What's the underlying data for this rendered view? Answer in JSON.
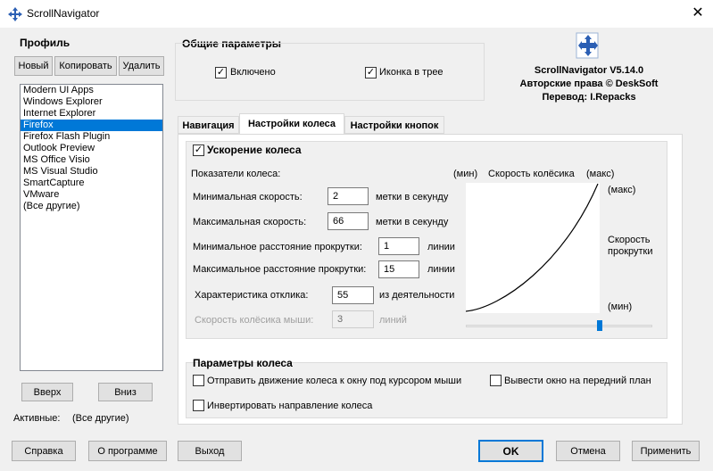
{
  "window": {
    "title": "ScrollNavigator"
  },
  "profile": {
    "title": "Профиль",
    "buttons": {
      "new": "Новый",
      "copy": "Копировать",
      "delete": "Удалить"
    },
    "items": [
      "Modern UI Apps",
      "Windows Explorer",
      "Internet Explorer",
      "Firefox",
      "Firefox Flash Plugin",
      "Outlook Preview",
      "MS Office Visio",
      "MS Visual Studio",
      "SmartCapture",
      "VMware",
      "(Все другие)"
    ],
    "selected_index": 3,
    "up": "Вверх",
    "down": "Вниз",
    "active_label": "Активные:",
    "active_value": "(Все другие)"
  },
  "general": {
    "title": "Общие параметры",
    "enabled_label": "Включено",
    "tray_label": "Иконка в трее",
    "enabled_checked": true,
    "tray_checked": true
  },
  "about": {
    "product": "ScrollNavigator V5.14.0",
    "copyright": "Авторские права © DeskSoft",
    "translation": "Перевод: I.Repacks"
  },
  "tabs": [
    "Навигация",
    "Настройки колеса",
    "Настройки кнопок"
  ],
  "active_tab": 1,
  "acceleration": {
    "checkbox_label": "Ускорение колеса",
    "checked": true,
    "header": "Показатели колеса:",
    "min_speed_label": "Минимальная скорость:",
    "min_speed_value": "2",
    "min_speed_unit": "метки в секунду",
    "max_speed_label": "Максимальная скорость:",
    "max_speed_value": "66",
    "max_speed_unit": "метки в секунду",
    "min_dist_label": "Минимальное расстояние прокрутки:",
    "min_dist_value": "1",
    "min_dist_unit": "линии",
    "max_dist_label": "Максимальное расстояние прокрутки:",
    "max_dist_value": "15",
    "max_dist_unit": "линии",
    "response_label": "Характеристика отклика:",
    "response_value": "55",
    "response_unit": "из деятельности",
    "mouse_speed_label": "Скорость колёсика мыши:",
    "mouse_speed_value": "3",
    "mouse_speed_unit": "линий",
    "graph_min_top": "(мин)",
    "graph_title": "Скорость колёсика",
    "graph_max_top": "(макс)",
    "graph_max_right": "(макс)",
    "graph_ylabel_line1": "Скорость",
    "graph_ylabel_line2": "прокрутки",
    "graph_min_right": "(мин)",
    "slider_value": 0.72
  },
  "wheel_params": {
    "title": "Параметры колеса",
    "send_label": "Отправить движение колеса к окну под курсором мыши",
    "foreground_label": "Вывести окно на передний план",
    "invert_label": "Инвертировать направление колеса",
    "send_checked": false,
    "foreground_checked": false,
    "invert_checked": false
  },
  "footer": {
    "help": "Справка",
    "about": "О программе",
    "exit": "Выход",
    "ok": "OK",
    "cancel": "Отмена",
    "apply": "Применить"
  }
}
